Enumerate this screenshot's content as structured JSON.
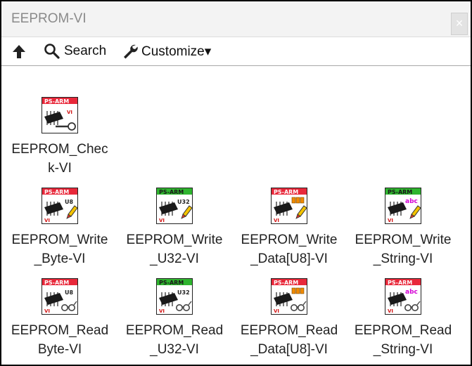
{
  "window": {
    "title": "EEPROM-VI",
    "close_symbol": "×"
  },
  "toolbar": {
    "up_icon": "up-arrow-icon",
    "search_label": "Search",
    "customize_label": "Customize▾"
  },
  "icon_banner": "PS-ARM",
  "vis": [
    {
      "label": "EEPROM_Chec\nk-VI",
      "kind": "check",
      "banner": "red",
      "tag": ""
    },
    {
      "label": "EEPROM_Write\n_Byte-VI",
      "kind": "write",
      "banner": "red",
      "tag": "U8"
    },
    {
      "label": "EEPROM_Write\n_U32-VI",
      "kind": "write",
      "banner": "green",
      "tag": "U32"
    },
    {
      "label": "EEPROM_Write\n_Data[U8]-VI",
      "kind": "write",
      "banner": "red",
      "tag": "array"
    },
    {
      "label": "EEPROM_Write\n_String-VI",
      "kind": "write",
      "banner": "green",
      "tag": "abc"
    },
    {
      "label": "EEPROM_Read\nByte-VI",
      "kind": "read",
      "banner": "red",
      "tag": "U8"
    },
    {
      "label": "EEPROM_Read\n_U32-VI",
      "kind": "read",
      "banner": "green",
      "tag": "U32"
    },
    {
      "label": "EEPROM_Read\n_Data[U8]-VI",
      "kind": "read",
      "banner": "red",
      "tag": "array"
    },
    {
      "label": "EEPROM_Read\n_String-VI",
      "kind": "read",
      "banner": "red",
      "tag": "abc"
    }
  ],
  "colors": {
    "banner_red": "#e8283a",
    "banner_green": "#2fb52f",
    "vi_text": "#d21414",
    "abc_text": "#d400d4",
    "array_orange": "#f08a00"
  }
}
